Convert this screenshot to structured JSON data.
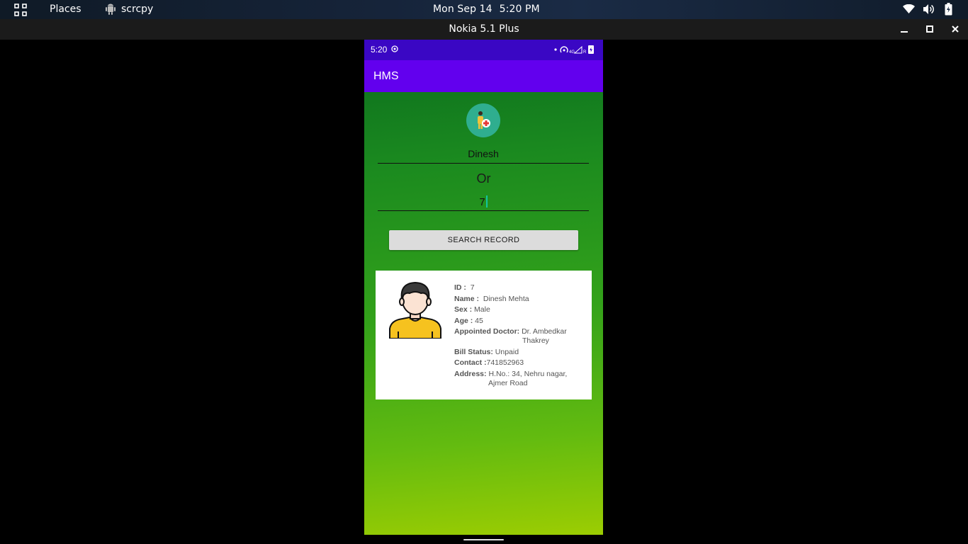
{
  "desktop": {
    "places_label": "Places",
    "app_name": "scrcpy",
    "clock_date": "Mon Sep 14",
    "clock_time": "5:20 PM"
  },
  "window": {
    "title": "Nokia 5.1 Plus"
  },
  "phone": {
    "status_time": "5:20",
    "app_title": "HMS",
    "name_value": "Dinesh",
    "or_label": "Or",
    "id_value": "7",
    "search_button": "SEARCH RECORD",
    "record": {
      "id_label": "ID :",
      "id_value": "7",
      "name_label": "Name :",
      "name_value": "Dinesh Mehta",
      "sex_label": "Sex :",
      "sex_value": "Male",
      "age_label": "Age :",
      "age_value": "45",
      "doctor_label": "Appointed Doctor:",
      "doctor_value_1": "Dr. Ambedkar",
      "doctor_value_2": "Thakrey",
      "bill_label": "Bill Status:",
      "bill_value": "Unpaid",
      "contact_label": "Contact :",
      "contact_value": "741852963",
      "address_label": "Address:",
      "address_value_1": "H.No.: 34, Nehru nagar,",
      "address_value_2": "Ajmer Road"
    }
  },
  "colors": {
    "status_bar": "#3a07c4",
    "app_bar": "#6200ee",
    "background_top": "#0a6b1e",
    "background_bottom": "#9ccd02"
  }
}
